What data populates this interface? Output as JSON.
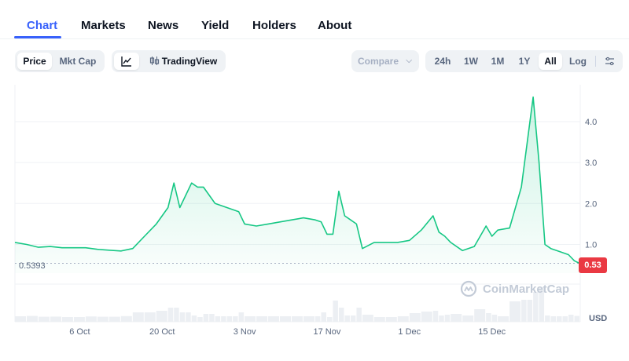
{
  "tabs": [
    {
      "label": "Chart",
      "active": true
    },
    {
      "label": "Markets"
    },
    {
      "label": "News"
    },
    {
      "label": "Yield"
    },
    {
      "label": "Holders"
    },
    {
      "label": "About"
    }
  ],
  "toolbar": {
    "metric_options": [
      "Price",
      "Mkt Cap"
    ],
    "metric_selected": "Price",
    "chart_style_icon": "line-chart-icon",
    "tradingview_label": "TradingView",
    "tradingview_icon": "candlestick-icon",
    "compare_label": "Compare",
    "ranges": [
      "24h",
      "1W",
      "1M",
      "1Y",
      "All"
    ],
    "range_selected": "All",
    "log_label": "Log",
    "settings_icon": "sliders-icon"
  },
  "watermark": "CoinMarketCap",
  "currency_label": "USD",
  "current_price_badge": "0.53",
  "low_price_label": "0.5393",
  "colors": {
    "accent": "#3861fb",
    "line": "#16c784",
    "badge": "#ea3943"
  },
  "chart_data": {
    "type": "area",
    "x_labels": [
      "6 Oct",
      "20 Oct",
      "3 Nov",
      "17 Nov",
      "1 Dec",
      "15 Dec"
    ],
    "y_ticks": [
      1.0,
      2.0,
      3.0,
      4.0
    ],
    "ylim": [
      0.3,
      4.9
    ],
    "grid": true,
    "series": [
      {
        "x": [
          "2023-09-25",
          "2023-09-27",
          "2023-09-29",
          "2023-10-01",
          "2023-10-03",
          "2023-10-05",
          "2023-10-07",
          "2023-10-09",
          "2023-10-11",
          "2023-10-13",
          "2023-10-15",
          "2023-10-17",
          "2023-10-19",
          "2023-10-21",
          "2023-10-22",
          "2023-10-23",
          "2023-10-24",
          "2023-10-25",
          "2023-10-26",
          "2023-10-27",
          "2023-10-28",
          "2023-10-29",
          "2023-10-30",
          "2023-10-31",
          "2023-11-01",
          "2023-11-02",
          "2023-11-03",
          "2023-11-05",
          "2023-11-07",
          "2023-11-09",
          "2023-11-11",
          "2023-11-13",
          "2023-11-15",
          "2023-11-16",
          "2023-11-17",
          "2023-11-18",
          "2023-11-19",
          "2023-11-20",
          "2023-11-21",
          "2023-11-22",
          "2023-11-23",
          "2023-11-25",
          "2023-11-27",
          "2023-11-29",
          "2023-12-01",
          "2023-12-03",
          "2023-12-05",
          "2023-12-06",
          "2023-12-07",
          "2023-12-08",
          "2023-12-10",
          "2023-12-12",
          "2023-12-14",
          "2023-12-15",
          "2023-12-16",
          "2023-12-18",
          "2023-12-20",
          "2023-12-21",
          "2023-12-22",
          "2023-12-23",
          "2023-12-24",
          "2023-12-25",
          "2023-12-26",
          "2023-12-27",
          "2023-12-28",
          "2023-12-29",
          "2023-12-30"
        ],
        "values": [
          1.05,
          1.0,
          0.93,
          0.95,
          0.92,
          0.92,
          0.92,
          0.88,
          0.86,
          0.84,
          0.9,
          1.2,
          1.5,
          1.9,
          2.5,
          1.9,
          2.2,
          2.5,
          2.4,
          2.4,
          2.2,
          2.0,
          1.95,
          1.9,
          1.85,
          1.8,
          1.5,
          1.45,
          1.5,
          1.55,
          1.6,
          1.65,
          1.6,
          1.55,
          1.25,
          1.25,
          2.3,
          1.7,
          1.6,
          1.5,
          0.9,
          1.05,
          1.05,
          1.05,
          1.1,
          1.35,
          1.7,
          1.3,
          1.2,
          1.05,
          0.85,
          0.95,
          1.45,
          1.2,
          1.35,
          1.4,
          2.4,
          3.5,
          4.6,
          3.0,
          1.0,
          0.9,
          0.85,
          0.8,
          0.75,
          0.6,
          0.53
        ]
      }
    ]
  }
}
